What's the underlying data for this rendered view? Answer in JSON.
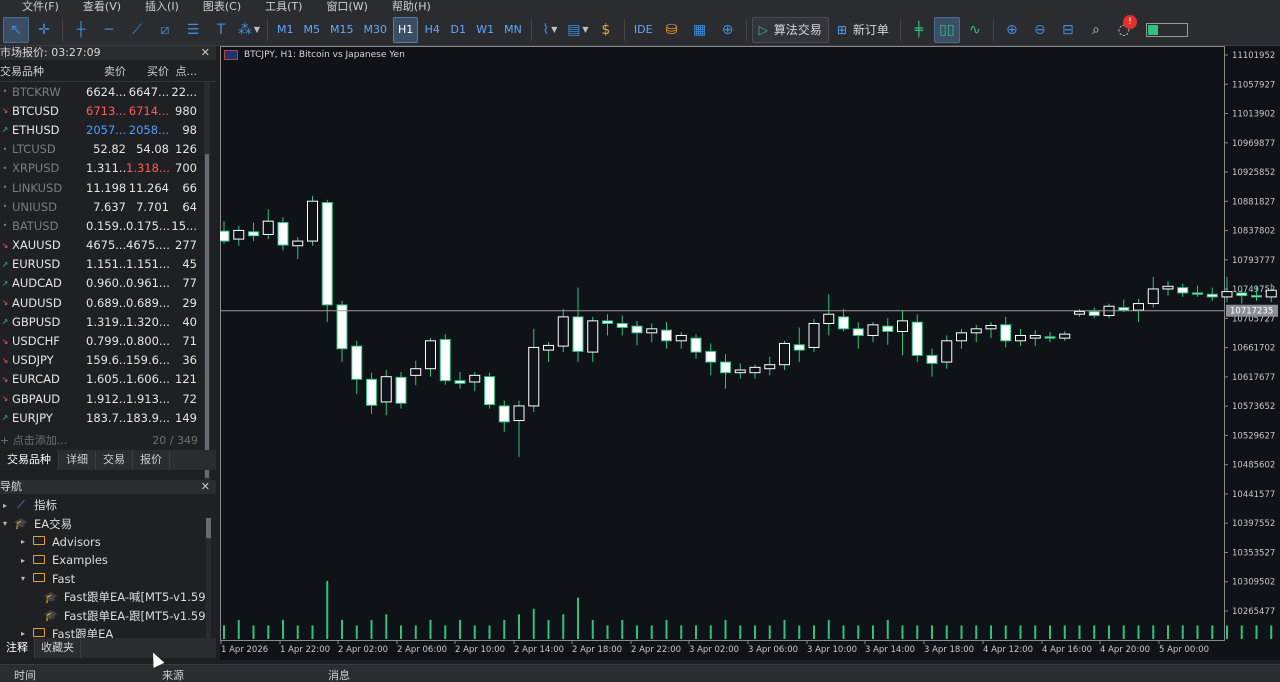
{
  "menu": [
    "文件(F)",
    "查看(V)",
    "插入(I)",
    "图表(C)",
    "工具(T)",
    "窗口(W)",
    "帮助(H)"
  ],
  "toolbar": {
    "timeframes": [
      "M1",
      "M5",
      "M15",
      "M30",
      "H1",
      "H4",
      "D1",
      "W1",
      "MN"
    ],
    "selected_timeframe": "H1",
    "ide_label": "IDE",
    "algo_trading_label": "算法交易",
    "new_order_label": "新订单",
    "notification_count": "!"
  },
  "market_watch": {
    "title": "市场报价: 03:27:09",
    "columns": [
      "交易品种",
      "卖价",
      "买价",
      "点..."
    ],
    "rows": [
      {
        "symbol": "BTCKRW",
        "bid": "6624...",
        "ask": "6647...",
        "spread": "22...",
        "dir": "flat",
        "dim": true,
        "bid_color": "",
        "ask_color": ""
      },
      {
        "symbol": "BTCUSD",
        "bid": "6713...",
        "ask": "6714...",
        "spread": "980",
        "dir": "down",
        "dim": false,
        "bid_color": "red",
        "ask_color": "red"
      },
      {
        "symbol": "ETHUSD",
        "bid": "2057...",
        "ask": "2058...",
        "spread": "98",
        "dir": "up",
        "dim": false,
        "bid_color": "blue",
        "ask_color": "blue"
      },
      {
        "symbol": "LTCUSD",
        "bid": "52.82",
        "ask": "54.08",
        "spread": "126",
        "dir": "flat",
        "dim": true,
        "bid_color": "",
        "ask_color": ""
      },
      {
        "symbol": "XRPUSD",
        "bid": "1.311...",
        "ask": "1.318...",
        "spread": "700",
        "dir": "flat",
        "dim": true,
        "bid_color": "",
        "ask_color": "red"
      },
      {
        "symbol": "LINKUSD",
        "bid": "11.198",
        "ask": "11.264",
        "spread": "66",
        "dir": "flat",
        "dim": true,
        "bid_color": "",
        "ask_color": ""
      },
      {
        "symbol": "UNIUSD",
        "bid": "7.637",
        "ask": "7.701",
        "spread": "64",
        "dir": "flat",
        "dim": true,
        "bid_color": "",
        "ask_color": ""
      },
      {
        "symbol": "BATUSD",
        "bid": "0.159...",
        "ask": "0.175...",
        "spread": "15...",
        "dir": "flat",
        "dim": true,
        "bid_color": "",
        "ask_color": ""
      },
      {
        "symbol": "XAUUSD",
        "bid": "4675....",
        "ask": "4675....",
        "spread": "277",
        "dir": "down",
        "dim": false,
        "bid_color": "",
        "ask_color": ""
      },
      {
        "symbol": "EURUSD",
        "bid": "1.151...",
        "ask": "1.151...",
        "spread": "45",
        "dir": "up",
        "dim": false,
        "bid_color": "",
        "ask_color": ""
      },
      {
        "symbol": "AUDCAD",
        "bid": "0.960...",
        "ask": "0.961...",
        "spread": "77",
        "dir": "up",
        "dim": false,
        "bid_color": "",
        "ask_color": ""
      },
      {
        "symbol": "AUDUSD",
        "bid": "0.689...",
        "ask": "0.689...",
        "spread": "29",
        "dir": "down",
        "dim": false,
        "bid_color": "",
        "ask_color": ""
      },
      {
        "symbol": "GBPUSD",
        "bid": "1.319...",
        "ask": "1.320...",
        "spread": "40",
        "dir": "up",
        "dim": false,
        "bid_color": "",
        "ask_color": ""
      },
      {
        "symbol": "USDCHF",
        "bid": "0.799...",
        "ask": "0.800...",
        "spread": "71",
        "dir": "down",
        "dim": false,
        "bid_color": "",
        "ask_color": ""
      },
      {
        "symbol": "USDJPY",
        "bid": "159.6...",
        "ask": "159.6...",
        "spread": "36",
        "dir": "down",
        "dim": false,
        "bid_color": "",
        "ask_color": ""
      },
      {
        "symbol": "EURCAD",
        "bid": "1.605...",
        "ask": "1.606...",
        "spread": "121",
        "dir": "down",
        "dim": false,
        "bid_color": "",
        "ask_color": ""
      },
      {
        "symbol": "GBPAUD",
        "bid": "1.912...",
        "ask": "1.913...",
        "spread": "72",
        "dir": "down",
        "dim": false,
        "bid_color": "",
        "ask_color": ""
      },
      {
        "symbol": "EURJPY",
        "bid": "183.7...",
        "ask": "183.9...",
        "spread": "149",
        "dir": "up",
        "dim": false,
        "bid_color": "",
        "ask_color": ""
      }
    ],
    "add_label": "+ 点击添加...",
    "count_label": "20 / 349",
    "tabs": [
      "交易品种",
      "详细",
      "交易",
      "报价"
    ],
    "active_tab": "交易品种"
  },
  "navigator": {
    "title": "导航",
    "items": [
      {
        "label": "指标",
        "level": 1,
        "icon": "indicator",
        "twisty": "▸"
      },
      {
        "label": "EA交易",
        "level": 1,
        "icon": "cap",
        "twisty": "▾"
      },
      {
        "label": "Advisors",
        "level": 2,
        "icon": "folder",
        "twisty": "▸"
      },
      {
        "label": "Examples",
        "level": 2,
        "icon": "folder",
        "twisty": "▸"
      },
      {
        "label": "Fast",
        "level": 2,
        "icon": "folder",
        "twisty": "▾"
      },
      {
        "label": "Fast跟单EA-喊[MT5-v1.59]",
        "level": 3,
        "icon": "cap",
        "twisty": ""
      },
      {
        "label": "Fast跟单EA-跟[MT5-v1.59]",
        "level": 3,
        "icon": "cap",
        "twisty": ""
      },
      {
        "label": "Fast跟单EA",
        "level": 2,
        "icon": "folder",
        "twisty": "▸"
      }
    ],
    "tabs": [
      "注释",
      "收藏夹"
    ],
    "active_tab": "注释"
  },
  "chart": {
    "label": "BTCJPY, H1:  Bitcoin vs Japanese Yen",
    "current_price": "10717235"
  },
  "chart_data": {
    "type": "candlestick",
    "y_axis_ticks": [
      "11101952",
      "11057927",
      "11013902",
      "10969877",
      "10925852",
      "10881827",
      "10837802",
      "10793777",
      "10749752",
      "10705727",
      "10661702",
      "10617677",
      "10573652",
      "10529627",
      "10485602",
      "10441577",
      "10397552",
      "10353527",
      "10309502",
      "10265477"
    ],
    "y_axis_values": [
      11101952,
      11057927,
      11013902,
      10969877,
      10925852,
      10881827,
      10837802,
      10793777,
      10749752,
      10705727,
      10661702,
      10617677,
      10573652,
      10529627,
      10485602,
      10441577,
      10397552,
      10353527,
      10309502,
      10265477
    ],
    "x_axis_labels": [
      "1 Apr 2026",
      "1 Apr 22:00",
      "2 Apr 02:00",
      "2 Apr 06:00",
      "2 Apr 10:00",
      "2 Apr 14:00",
      "2 Apr 18:00",
      "2 Apr 22:00",
      "3 Apr 02:00",
      "3 Apr 06:00",
      "3 Apr 10:00",
      "3 Apr 14:00",
      "3 Apr 18:00",
      "4 Apr 12:00",
      "4 Apr 16:00",
      "4 Apr 20:00",
      "5 Apr 00:00"
    ],
    "current_price": 10717235,
    "up_color": "#ffffff",
    "down_color": "#ffffff",
    "wick_color": "#2ec27e",
    "candles": [
      [
        10837000,
        10852000,
        10818000,
        10822000
      ],
      [
        10825000,
        10845000,
        10815000,
        10838000
      ],
      [
        10836000,
        10850000,
        10822000,
        10830000
      ],
      [
        10832000,
        10870000,
        10825000,
        10852000
      ],
      [
        10850000,
        10858000,
        10808000,
        10816000
      ],
      [
        10815000,
        10828000,
        10795000,
        10822000
      ],
      [
        10822000,
        10890000,
        10815000,
        10882000
      ],
      [
        10880000,
        10884000,
        10700000,
        10726000
      ],
      [
        10726000,
        10732000,
        10640000,
        10660000
      ],
      [
        10664000,
        10672000,
        10592000,
        10614000
      ],
      [
        10614000,
        10624000,
        10562000,
        10575000
      ],
      [
        10580000,
        10628000,
        10560000,
        10618000
      ],
      [
        10617000,
        10625000,
        10570000,
        10578000
      ],
      [
        10620000,
        10642000,
        10605000,
        10630000
      ],
      [
        10630000,
        10676000,
        10618000,
        10672000
      ],
      [
        10674000,
        10682000,
        10606000,
        10612000
      ],
      [
        10612000,
        10625000,
        10600000,
        10608000
      ],
      [
        10610000,
        10625000,
        10596000,
        10620000
      ],
      [
        10618000,
        10624000,
        10570000,
        10576000
      ],
      [
        10574000,
        10582000,
        10535000,
        10550000
      ],
      [
        10552000,
        10582000,
        10497000,
        10574000
      ],
      [
        10574000,
        10690000,
        10565000,
        10662000
      ],
      [
        10658000,
        10670000,
        10640000,
        10665000
      ],
      [
        10664000,
        10720000,
        10655000,
        10708000
      ],
      [
        10708000,
        10752000,
        10640000,
        10656000
      ],
      [
        10655000,
        10708000,
        10640000,
        10702000
      ],
      [
        10702000,
        10712000,
        10680000,
        10698000
      ],
      [
        10698000,
        10710000,
        10680000,
        10692000
      ],
      [
        10694000,
        10702000,
        10665000,
        10684000
      ],
      [
        10684000,
        10698000,
        10670000,
        10690000
      ],
      [
        10688000,
        10700000,
        10660000,
        10672000
      ],
      [
        10672000,
        10685000,
        10660000,
        10680000
      ],
      [
        10676000,
        10682000,
        10645000,
        10655000
      ],
      [
        10656000,
        10668000,
        10620000,
        10640000
      ],
      [
        10640000,
        10652000,
        10600000,
        10624000
      ],
      [
        10624000,
        10638000,
        10615000,
        10628000
      ],
      [
        10624000,
        10636000,
        10615000,
        10632000
      ],
      [
        10630000,
        10648000,
        10620000,
        10636000
      ],
      [
        10636000,
        10672000,
        10628000,
        10668000
      ],
      [
        10666000,
        10692000,
        10640000,
        10658000
      ],
      [
        10662000,
        10705000,
        10655000,
        10698000
      ],
      [
        10698000,
        10742000,
        10680000,
        10712000
      ],
      [
        10708000,
        10720000,
        10686000,
        10690000
      ],
      [
        10690000,
        10700000,
        10660000,
        10680000
      ],
      [
        10680000,
        10700000,
        10670000,
        10696000
      ],
      [
        10694000,
        10706000,
        10666000,
        10686000
      ],
      [
        10686000,
        10718000,
        10650000,
        10702000
      ],
      [
        10700000,
        10712000,
        10640000,
        10650000
      ],
      [
        10650000,
        10660000,
        10618000,
        10638000
      ],
      [
        10640000,
        10680000,
        10630000,
        10672000
      ],
      [
        10672000,
        10690000,
        10660000,
        10684000
      ],
      [
        10684000,
        10696000,
        10670000,
        10690000
      ],
      [
        10690000,
        10700000,
        10676000,
        10695000
      ],
      [
        10696000,
        10708000,
        10662000,
        10672000
      ],
      [
        10672000,
        10690000,
        10664000,
        10680000
      ],
      [
        10676000,
        10688000,
        10664000,
        10680000
      ],
      [
        10678000,
        10685000,
        10670000,
        10676000
      ],
      [
        10676000,
        10686000,
        10672000,
        10682000
      ],
      [
        10712000,
        10720000,
        10708000,
        10716000
      ],
      [
        10716000,
        10722000,
        10706000,
        10710000
      ],
      [
        10710000,
        10728000,
        10706000,
        10724000
      ],
      [
        10722000,
        10734000,
        10715000,
        10718000
      ],
      [
        10718000,
        10735000,
        10700000,
        10728000
      ],
      [
        10728000,
        10768000,
        10722000,
        10750000
      ],
      [
        10750000,
        10762000,
        10740000,
        10754000
      ],
      [
        10752000,
        10758000,
        10738000,
        10744000
      ],
      [
        10744000,
        10755000,
        10738000,
        10742000
      ],
      [
        10742000,
        10752000,
        10732000,
        10738000
      ],
      [
        10738000,
        10768000,
        10730000,
        10746000
      ],
      [
        10744000,
        10752000,
        10728000,
        10740000
      ],
      [
        10740000,
        10755000,
        10732000,
        10738000
      ],
      [
        10738000,
        10758000,
        10730000,
        10748000
      ],
      [
        10748000,
        10760000,
        10740000,
        10756000
      ],
      [
        10754000,
        10760000,
        10738000,
        10740000
      ],
      [
        10742000,
        10755000,
        10725000,
        10730000
      ],
      [
        10730000,
        10740000,
        10712000,
        10716000
      ],
      [
        10716000,
        10726000,
        10690000,
        10708000
      ],
      [
        10706000,
        10722000,
        10700000,
        10718000
      ],
      [
        10716000,
        10722000,
        10712000,
        10718000
      ]
    ],
    "volumes": [
      1,
      2,
      1,
      1,
      2,
      1,
      1,
      9,
      2,
      1,
      2,
      3,
      1,
      1,
      2,
      1,
      2,
      1,
      1,
      2,
      3,
      4,
      2,
      3,
      6,
      2,
      1,
      2,
      1,
      1,
      2,
      1,
      1,
      1,
      2,
      1,
      1,
      1,
      2,
      1,
      1,
      2,
      1,
      1,
      1,
      2,
      1,
      1,
      1,
      1,
      1,
      1,
      1,
      1,
      1,
      1,
      1,
      1,
      1,
      1,
      1,
      1,
      1,
      1,
      1,
      1,
      1,
      1,
      1,
      1,
      1,
      1,
      1,
      1,
      1,
      1,
      1,
      1,
      1
    ]
  },
  "bottom_bar": {
    "col_time": "时间",
    "col_source": "来源",
    "col_message": "消息"
  },
  "colors": {
    "accent": "#3b8fe0",
    "green": "#2ec27e",
    "red": "#ff5a5a",
    "chart_bg": "#0f1216"
  }
}
